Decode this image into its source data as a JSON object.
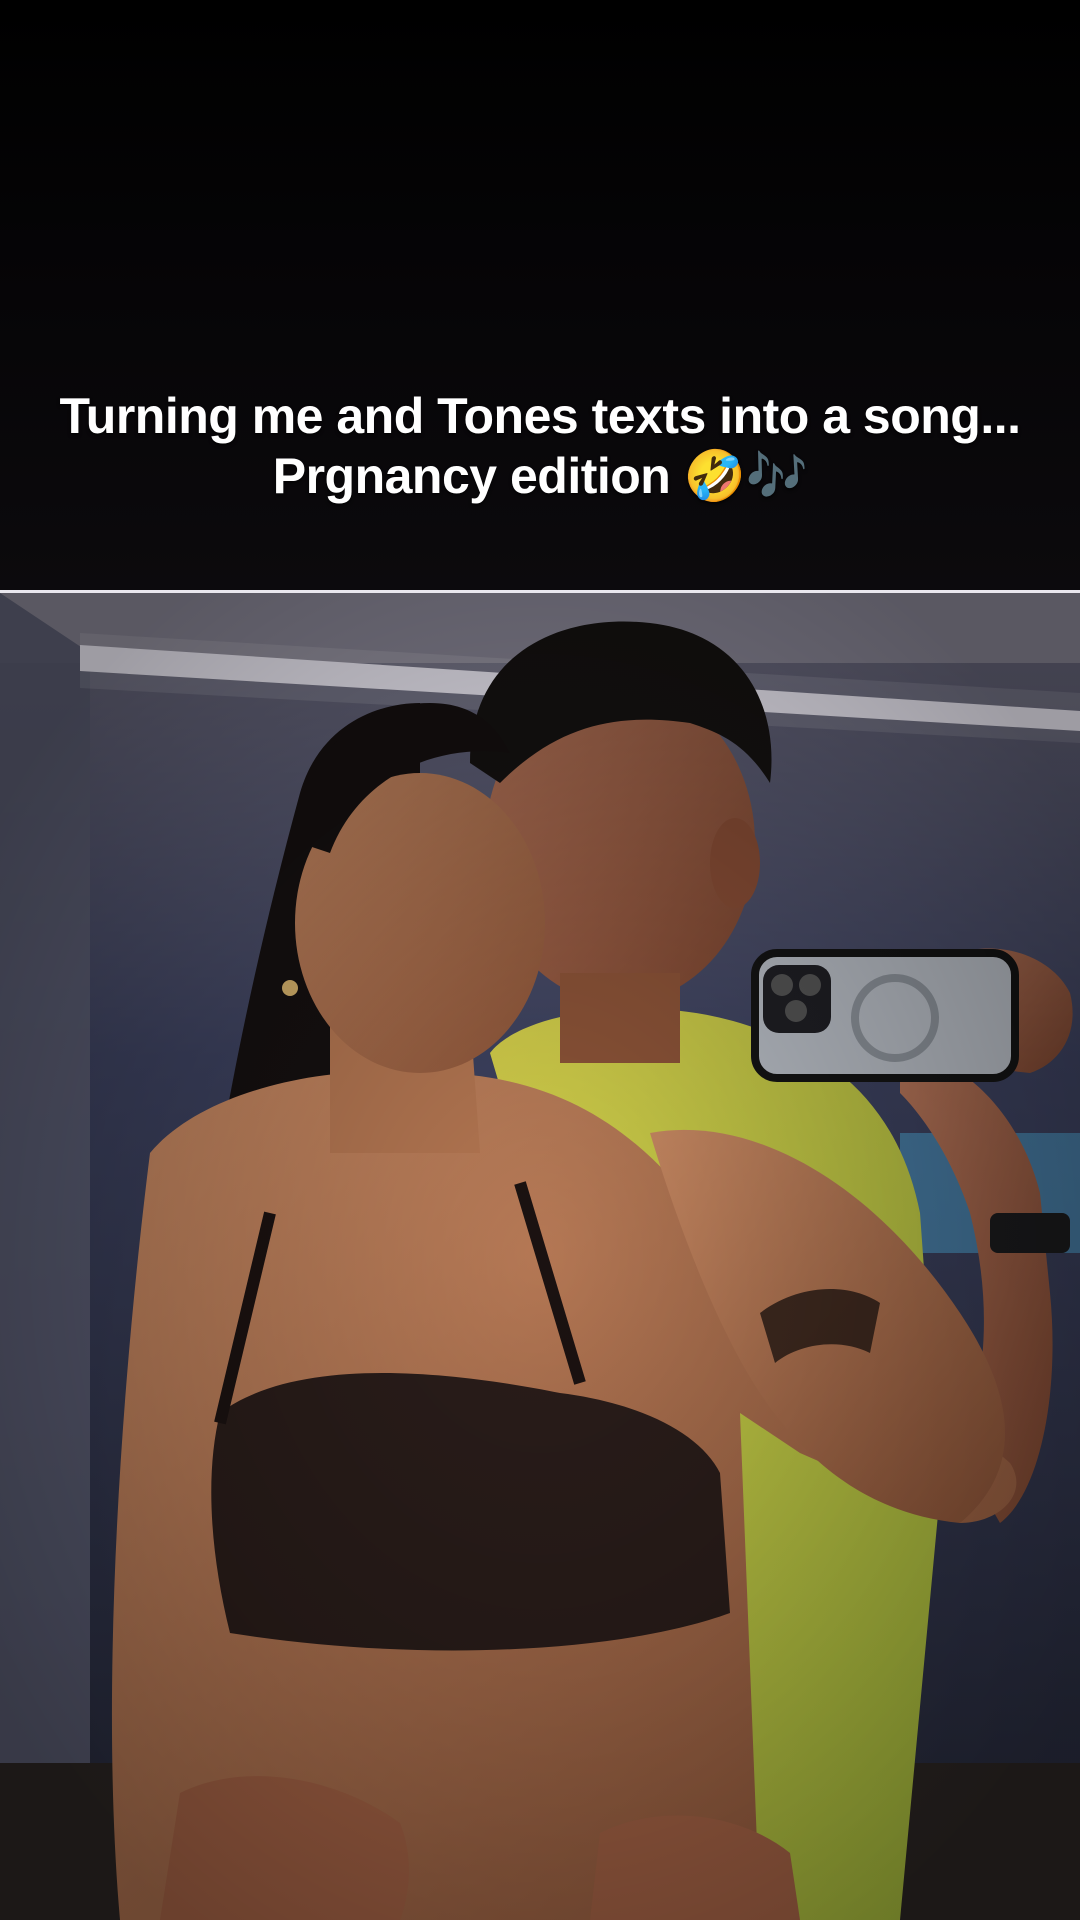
{
  "caption": {
    "line1": "Turning me and Tones texts into a song...",
    "line2": "Prgnancy edition 🤣🎶"
  },
  "photo": {
    "description_icon": "couple-mirror-selfie-image"
  },
  "colors": {
    "background": "#050505",
    "divider": "#e9e7ee",
    "caption_text": "#ffffff"
  }
}
